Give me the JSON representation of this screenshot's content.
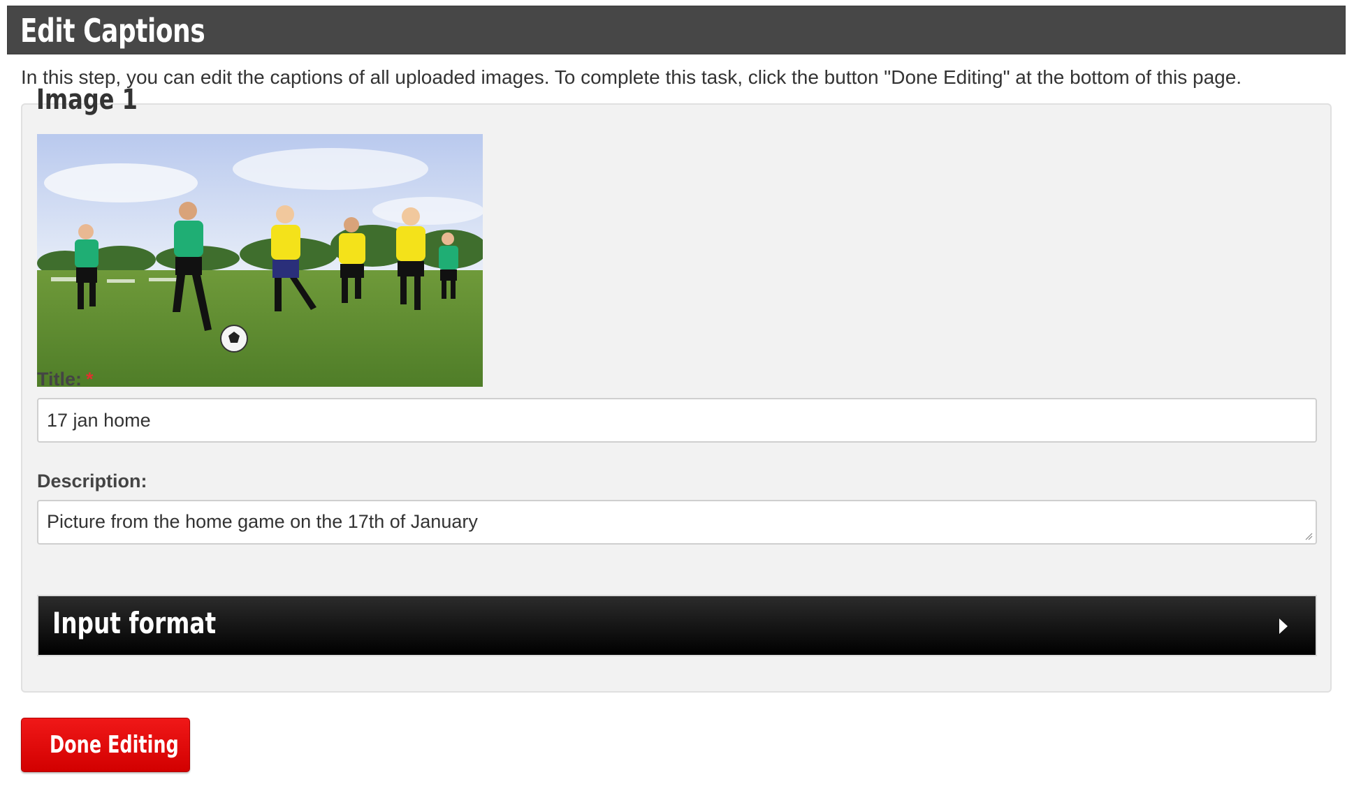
{
  "page": {
    "title": "Edit Captions",
    "intro": "In this step, you can edit the captions of all uploaded images. To complete this task, click the button \"Done Editing\" at the bottom of this page."
  },
  "image_group": {
    "legend": "Image 1",
    "photo_icon": "soccer-photo",
    "title_label": "Title:",
    "required_marker": "*",
    "title_value": "17 jan home",
    "description_label": "Description:",
    "description_value": "Picture from the home game on the 17th of January",
    "input_format_label": "Input format",
    "input_format_icon": "caret-right-icon"
  },
  "actions": {
    "done_label": "Done Editing"
  },
  "colors": {
    "header_bg": "#474747",
    "panel_bg": "#f2f2f2",
    "required": "#e0312f",
    "button_red": "#e00000",
    "format_bar": "#000000"
  }
}
